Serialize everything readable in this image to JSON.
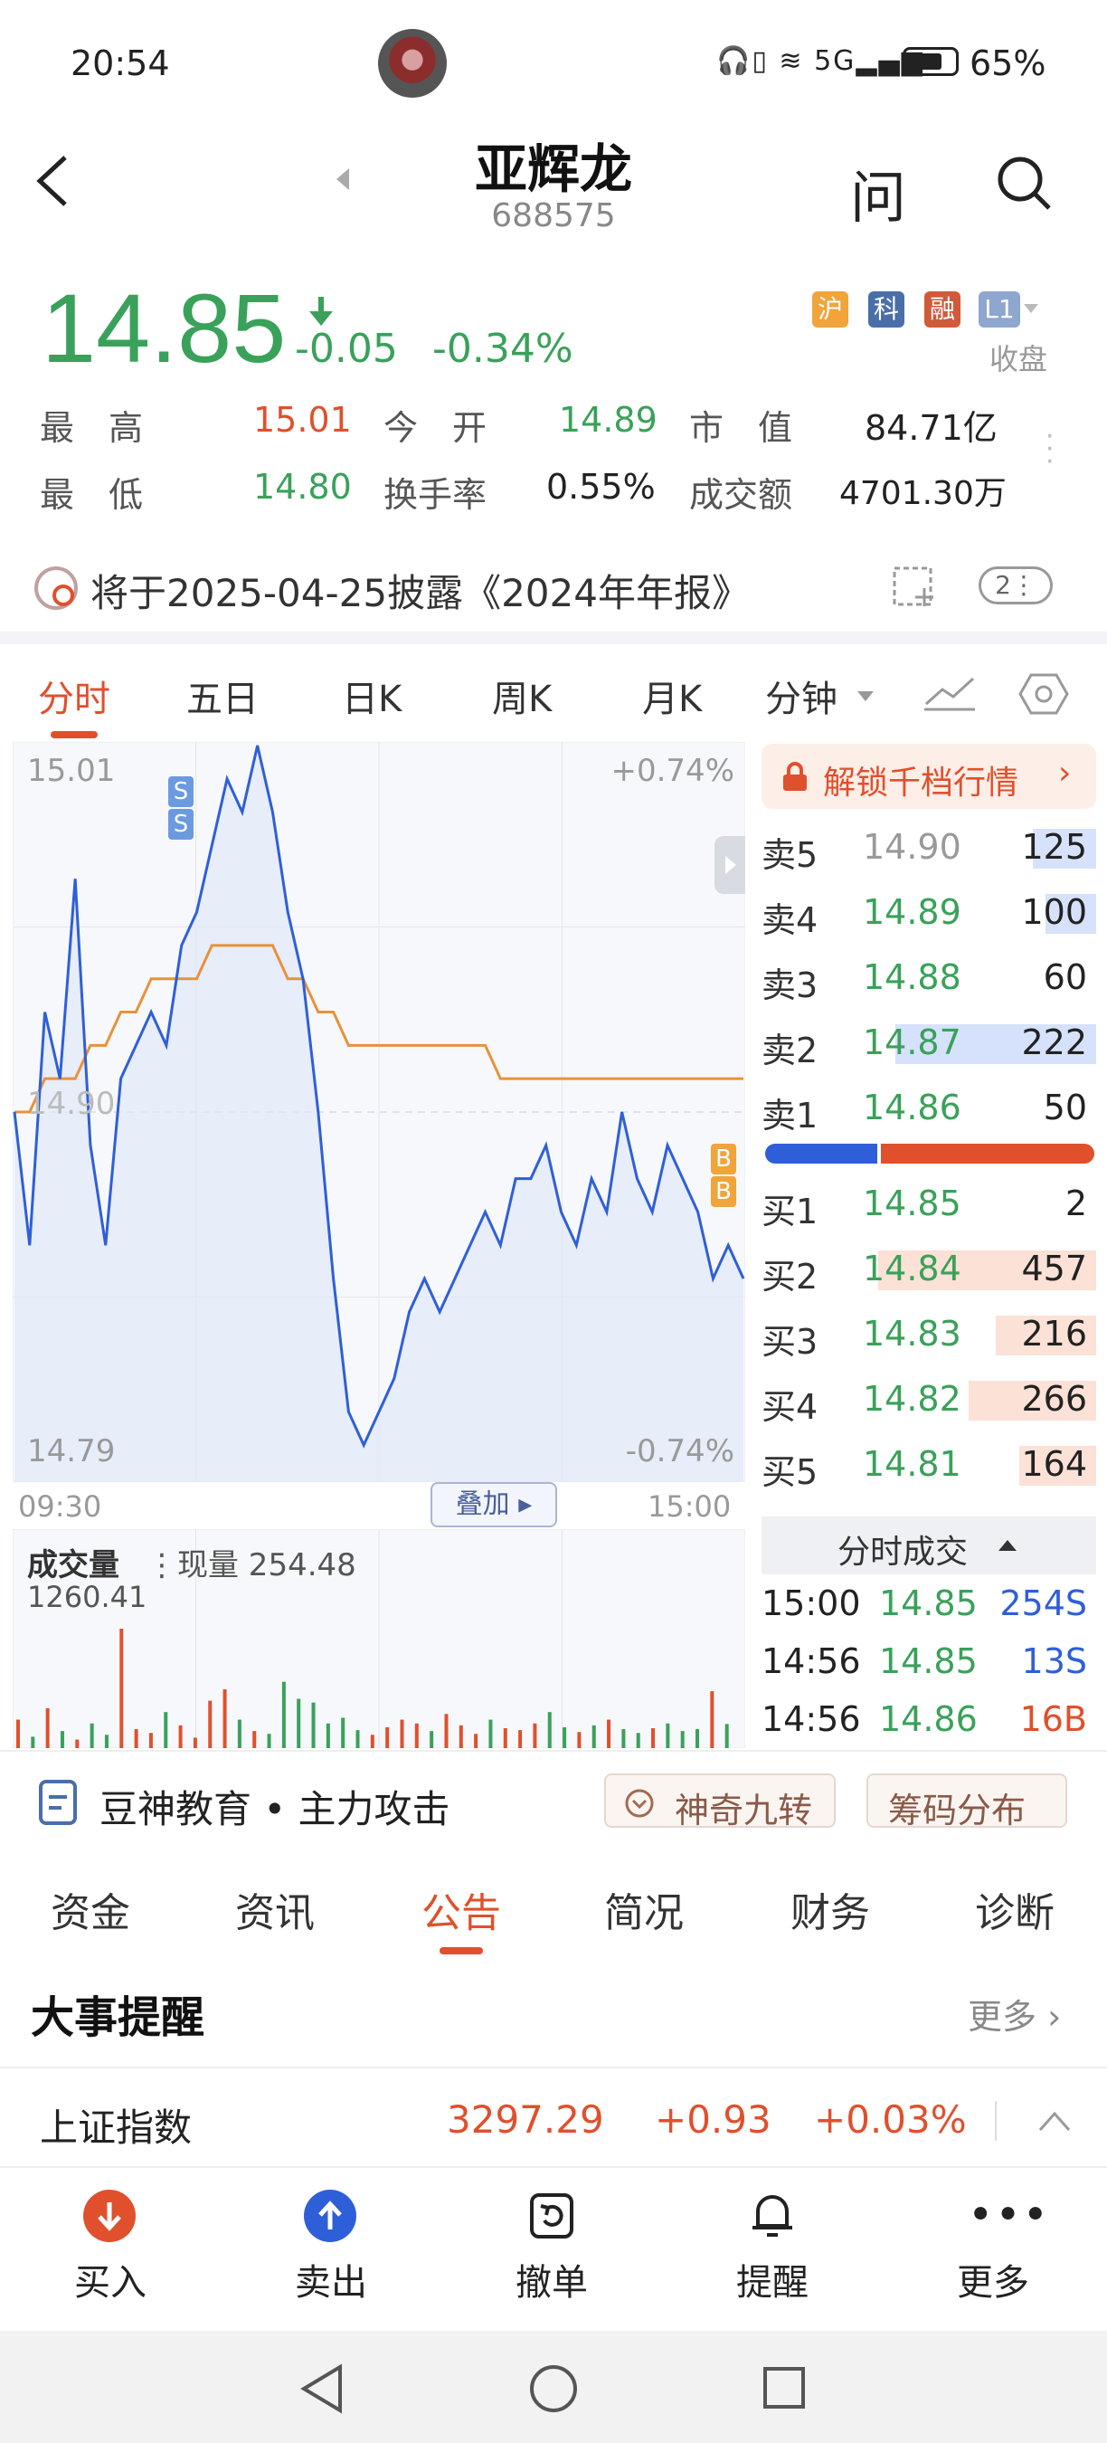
{
  "status_bar": {
    "time": "20:54",
    "signal_label": "5G",
    "battery": "65%"
  },
  "header": {
    "title": "亚辉龙",
    "code": "688575",
    "ask_label": "问"
  },
  "price": {
    "last": "14.85",
    "change": "-0.05",
    "change_pct": "-0.34%",
    "tags": [
      "沪",
      "科",
      "融",
      "L1"
    ],
    "state": "收盘",
    "stats": {
      "high_label": "最　高",
      "high": "15.01",
      "open_label": "今　开",
      "open": "14.89",
      "mktcap_label": "市　值",
      "mktcap": "84.71亿",
      "low_label": "最　低",
      "low": "14.80",
      "turnover_label": "换手率",
      "turnover": "0.55%",
      "amount_label": "成交额",
      "amount": "4701.30万"
    }
  },
  "notice": {
    "text": "将于2025-04-25披露《2024年年报》",
    "badge": "2"
  },
  "chart_tabs": [
    "分时",
    "五日",
    "日K",
    "周K",
    "月K",
    "分钟"
  ],
  "chart": {
    "y_max_label": "15.01",
    "y_min_label": "14.79",
    "y_mid_label": "14.90",
    "pct_max": "+0.74%",
    "pct_min": "-0.74%",
    "time_start": "09:30",
    "time_end": "15:00",
    "overlay_label": "叠加",
    "markers": [
      "S",
      "S",
      "B",
      "B"
    ]
  },
  "volume": {
    "title": "成交量",
    "current_label": "现量 254.48",
    "max_label": "1260.41"
  },
  "chart_data": {
    "type": "line",
    "title": "",
    "xlabel": "",
    "ylabel": "",
    "x_range": [
      "09:30",
      "15:00"
    ],
    "ylim": [
      14.79,
      15.01
    ],
    "series": [
      {
        "name": "",
        "values": [
          14.9,
          14.86,
          14.93,
          14.91,
          14.97,
          14.89,
          14.86,
          14.91,
          14.92,
          14.93,
          14.92,
          14.95,
          14.96,
          14.98,
          15.0,
          14.99,
          15.01,
          14.99,
          14.96,
          14.94,
          14.9,
          14.85,
          14.81,
          14.8,
          14.81,
          14.82,
          14.84,
          14.85,
          14.84,
          14.85,
          14.86,
          14.87,
          14.86,
          14.88,
          14.88,
          14.89,
          14.87,
          14.86,
          14.88,
          14.87,
          14.9,
          14.88,
          14.87,
          14.89,
          14.88,
          14.87,
          14.85,
          14.86,
          14.85
        ]
      },
      {
        "name": "",
        "values": [
          14.9,
          14.9,
          14.91,
          14.91,
          14.91,
          14.92,
          14.92,
          14.93,
          14.93,
          14.94,
          14.94,
          14.94,
          14.94,
          14.95,
          14.95,
          14.95,
          14.95,
          14.95,
          14.94,
          14.94,
          14.93,
          14.93,
          14.92,
          14.92,
          14.92,
          14.92,
          14.92,
          14.92,
          14.92,
          14.92,
          14.92,
          14.92,
          14.91,
          14.91,
          14.91,
          14.91,
          14.91,
          14.91,
          14.91,
          14.91,
          14.91,
          14.91,
          14.91,
          14.91,
          14.91,
          14.91,
          14.91,
          14.91,
          14.91
        ]
      }
    ],
    "volume_values": [
      300,
      120,
      420,
      180,
      90,
      260,
      140,
      1260,
      200,
      160,
      380,
      240,
      110,
      500,
      620,
      300,
      180,
      150,
      700,
      520,
      480,
      260,
      320,
      190,
      140,
      220,
      300,
      260,
      180,
      360,
      240,
      150,
      300,
      210,
      190,
      260,
      380,
      220,
      170,
      240,
      300,
      200,
      160,
      210,
      260,
      180,
      200,
      600,
      254
    ]
  },
  "order_book": {
    "unlock_label": "解锁千档行情",
    "asks": [
      {
        "label": "卖5",
        "price": "14.90",
        "vol": "125",
        "ratio": 0.19
      },
      {
        "label": "卖4",
        "price": "14.89",
        "vol": "100",
        "ratio": 0.15
      },
      {
        "label": "卖3",
        "price": "14.88",
        "vol": "60",
        "ratio": 0.0
      },
      {
        "label": "卖2",
        "price": "14.87",
        "vol": "222",
        "ratio": 0.6
      },
      {
        "label": "卖1",
        "price": "14.86",
        "vol": "50",
        "ratio": 0.0
      }
    ],
    "bids": [
      {
        "label": "买1",
        "price": "14.85",
        "vol": "2",
        "ratio": 0.0
      },
      {
        "label": "买2",
        "price": "14.84",
        "vol": "457",
        "ratio": 0.65
      },
      {
        "label": "买3",
        "price": "14.83",
        "vol": "216",
        "ratio": 0.3
      },
      {
        "label": "买4",
        "price": "14.82",
        "vol": "266",
        "ratio": 0.38
      },
      {
        "label": "买5",
        "price": "14.81",
        "vol": "164",
        "ratio": 0.23
      }
    ],
    "ticks_label": "分时成交",
    "ticks": [
      {
        "time": "15:00",
        "price": "14.85",
        "vol": "254S"
      },
      {
        "time": "14:56",
        "price": "14.85",
        "vol": "13S"
      },
      {
        "time": "14:56",
        "price": "14.86",
        "vol": "16B"
      }
    ]
  },
  "edu": {
    "text": "豆神教育 • 主力攻击",
    "btn1": "神奇九转",
    "btn2": "筹码分布"
  },
  "func_tabs": [
    "资金",
    "资讯",
    "公告",
    "简况",
    "财务",
    "诊断"
  ],
  "events": {
    "title": "大事提醒",
    "more": "更多"
  },
  "index_bar": {
    "name": "上证指数",
    "value": "3297.29",
    "change": "+0.93",
    "pct": "+0.03%"
  },
  "bottom_nav": [
    "买入",
    "卖出",
    "撤单",
    "提醒",
    "更多"
  ],
  "colors": {
    "up": "#e0502c",
    "down": "#3aa15a",
    "accent": "#e0502c",
    "line": "#2f5fd8",
    "avg": "#e8923a"
  }
}
